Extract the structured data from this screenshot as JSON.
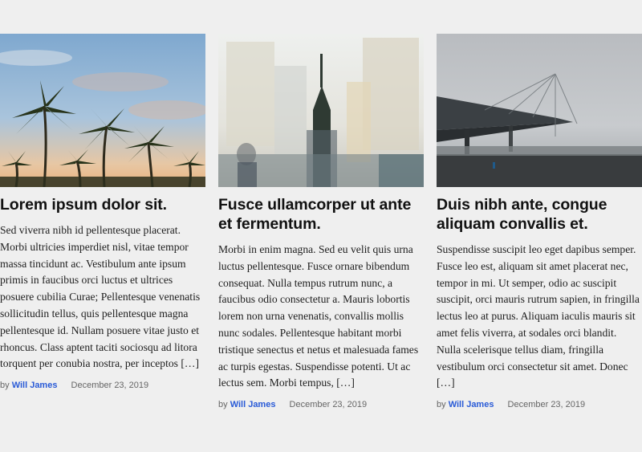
{
  "posts": [
    {
      "image": "palm-trees-photo",
      "title": "Lorem ipsum dolor sit.",
      "excerpt": "Sed viverra nibh id pellentesque placerat. Morbi ultricies imperdiet nisl, vitae tempor massa tincidunt ac. Vestibulum ante ipsum primis in faucibus orci luctus et ultrices posuere cubilia Curae; Pellentesque venenatis sollicitudin tellus, quis pellentesque magna pellentesque id. Nullam posuere vitae justo et rhoncus. Class aptent taciti sociosqu ad litora torquent per conubia nostra, per inceptos […]",
      "by": "by",
      "author": "Will James",
      "date": "December 23, 2019"
    },
    {
      "image": "city-double-exposure-photo",
      "title": "Fusce ullamcorper ut ante et fermentum.",
      "excerpt": "Morbi in enim magna. Sed eu velit quis urna luctus pellentesque. Fusce ornare bibendum consequat. Nulla tempus rutrum nunc, a faucibus odio consectetur a. Mauris lobortis lorem non urna venenatis, convallis mollis nunc sodales. Pellentesque habitant morbi tristique senectus et netus et malesuada fames ac turpis egestas. Suspendisse potenti. Ut ac lectus sem. Morbi tempus, […]",
      "by": "by",
      "author": "Will James",
      "date": "December 23, 2019"
    },
    {
      "image": "foggy-bridge-photo",
      "title": "Duis nibh ante, congue aliquam convallis et.",
      "excerpt": "Suspendisse suscipit leo eget dapibus semper. Fusce leo est, aliquam sit amet placerat nec, tempor in mi. Ut semper, odio ac suscipit suscipit, orci mauris rutrum sapien, in fringilla lectus leo at purus. Aliquam iaculis mauris sit amet felis viverra, at sodales orci blandit. Nulla scelerisque tellus diam, fringilla vestibulum orci consectetur sit amet. Donec […]",
      "by": "by",
      "author": "Will James",
      "date": "December 23, 2019"
    }
  ]
}
